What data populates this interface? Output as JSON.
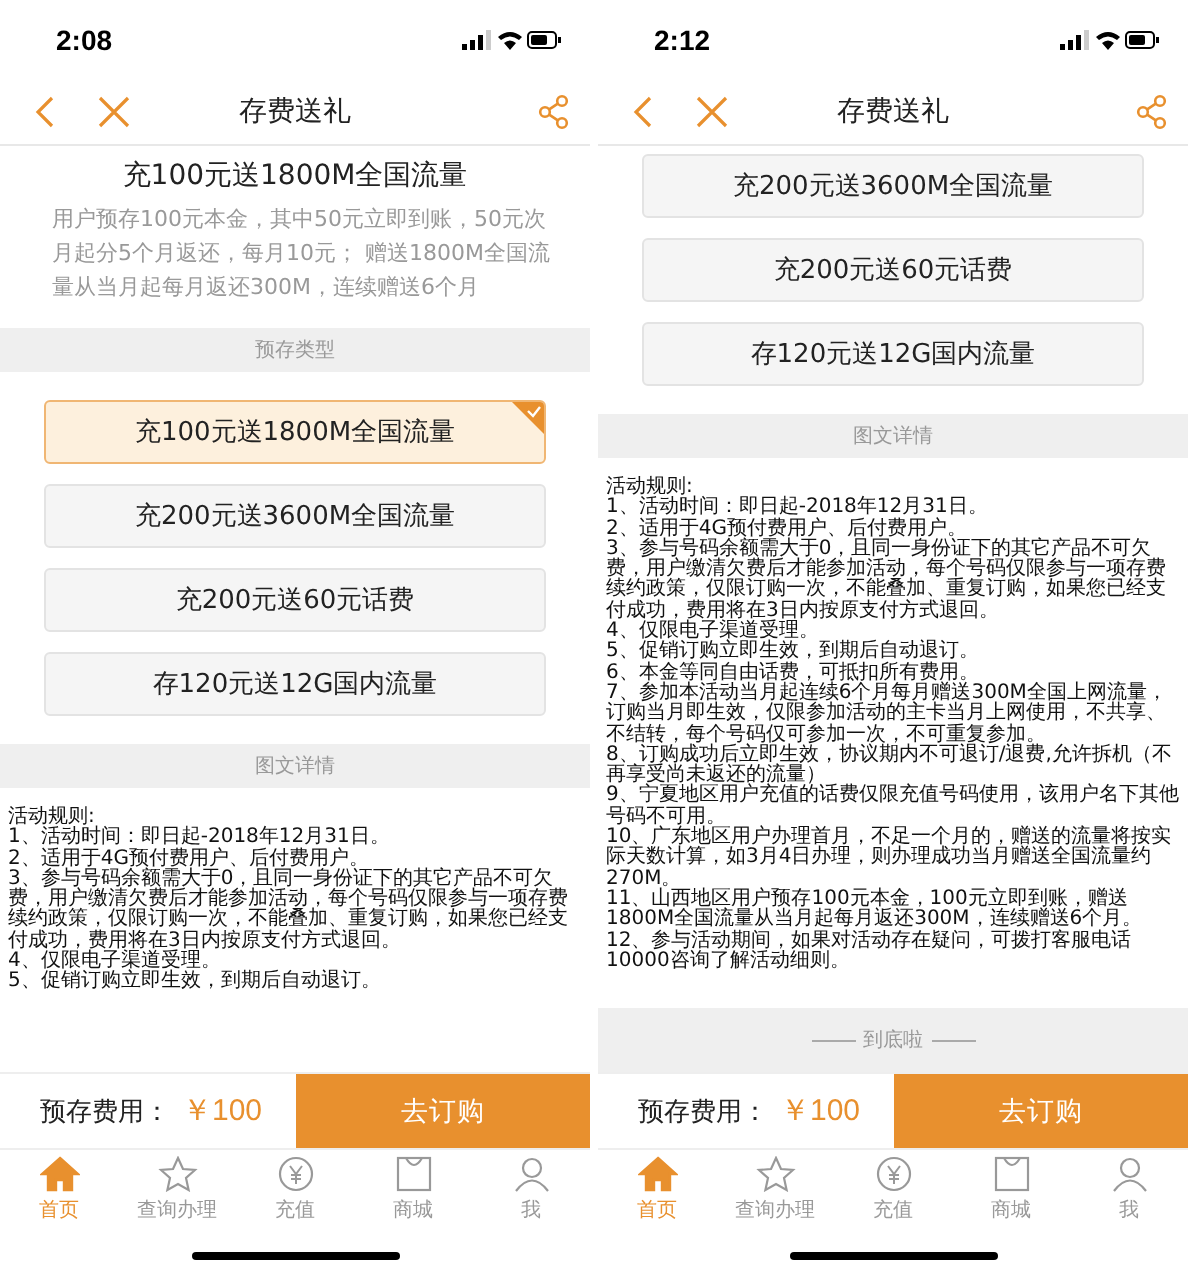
{
  "screens": [
    {
      "time": "2:08",
      "title": "存费送礼",
      "product": {
        "title": "充100元送1800M全国流量",
        "description": "用户预存100元本金，其中50元立即到账，50元次月起分5个月返还，每月10元； 赠送1800M全国流量从当月起每月返还300M，连续赠送6个月"
      },
      "section_label": "预存类型",
      "options": [
        {
          "label": "充100元送1800M全国流量",
          "selected": true
        },
        {
          "label": "充200元送3600M全国流量",
          "selected": false
        },
        {
          "label": "充200元送60元话费",
          "selected": false
        },
        {
          "label": "存120元送12G国内流量",
          "selected": false
        }
      ],
      "details_label": "图文详情",
      "rules": [
        "活动规则:",
        "1、活动时间：即日起-2018年12月31日。",
        "2、适用于4G预付费用户、后付费用户。",
        "3、参与号码余额需大于0，且同一身份证下的其它产品不可欠费，用户缴清欠费后才能参加活动，每个号码仅限参与一项存费续约政策，仅限订购一次，不能叠加、重复订购，如果您已经支付成功，费用将在3日内按原支付方式退回。",
        "4、仅限电子渠道受理。",
        "5、促销订购立即生效，到期后自动退订。"
      ],
      "price_label": "预存费用：",
      "price": "￥100",
      "order_button": "去订购",
      "tabs": [
        {
          "label": "首页",
          "selected": true
        },
        {
          "label": "查询办理",
          "selected": false
        },
        {
          "label": "充值",
          "selected": false
        },
        {
          "label": "商城",
          "selected": false
        },
        {
          "label": "我",
          "selected": false
        }
      ]
    },
    {
      "time": "2:12",
      "title": "存费送礼",
      "options": [
        {
          "label": "充200元送3600M全国流量",
          "selected": false
        },
        {
          "label": "充200元送60元话费",
          "selected": false
        },
        {
          "label": "存120元送12G国内流量",
          "selected": false
        }
      ],
      "details_label": "图文详情",
      "rules": [
        "活动规则:",
        "1、活动时间：即日起-2018年12月31日。",
        "2、适用于4G预付费用户、后付费用户。",
        "3、参与号码余额需大于0，且同一身份证下的其它产品不可欠费，用户缴清欠费后才能参加活动，每个号码仅限参与一项存费续约政策，仅限订购一次，不能叠加、重复订购，如果您已经支付成功，费用将在3日内按原支付方式退回。",
        "4、仅限电子渠道受理。",
        "5、促销订购立即生效，到期后自动退订。",
        "6、本金等同自由话费，可抵扣所有费用。",
        "7、参加本活动当月起连续6个月每月赠送300M全国上网流量，订购当月即生效，仅限参加活动的主卡当月上网使用，不共享、不结转，每个号码仅可参加一次，不可重复参加。",
        "8、订购成功后立即生效，协议期内不可退订/退费,允许拆机（不再享受尚未返还的流量）",
        "9、宁夏地区用户充值的话费仅限充值号码使用，该用户名下其他号码不可用。",
        "10、广东地区用户办理首月，不足一个月的，赠送的流量将按实际天数计算，如3月4日办理，则办理成功当月赠送全国流量约270M。",
        "11、山西地区用户预存100元本金，100元立即到账，赠送1800M全国流量从当月起每月返还300M，连续赠送6个月。",
        "12、参与活动期间，如果对活动存在疑问，可拨打客服电话10000咨询了解活动细则。"
      ],
      "end_note": "到底啦",
      "price_label": "预存费用：",
      "price": "￥100",
      "order_button": "去订购",
      "tabs": [
        {
          "label": "首页",
          "selected": true
        },
        {
          "label": "查询办理",
          "selected": false
        },
        {
          "label": "充值",
          "selected": false
        },
        {
          "label": "商城",
          "selected": false
        },
        {
          "label": "我",
          "selected": false
        }
      ]
    }
  ]
}
